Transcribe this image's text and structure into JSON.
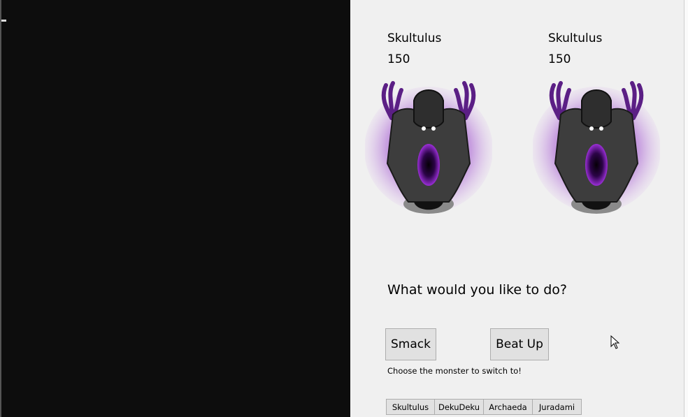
{
  "battle": {
    "player": {
      "name": "Skultulus",
      "hp": "150"
    },
    "opponent": {
      "name": "Skultulus",
      "hp": "150"
    }
  },
  "prompt": "What would you like to do?",
  "moves": [
    {
      "label": "Smack"
    },
    {
      "label": "Beat Up"
    }
  ],
  "switch_hint": "Choose the monster to switch to!",
  "switch_options": [
    "Skultulus",
    "DekuDeku",
    "Archaeda",
    "Juradami"
  ],
  "colors": {
    "aura": "#a95fd0",
    "body": "#3a3a3a",
    "core": "#5a0a8c",
    "horn": "#6b2a96"
  }
}
